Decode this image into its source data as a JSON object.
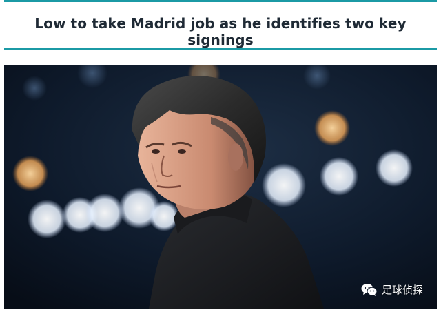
{
  "article": {
    "headline": "Low to take Madrid job as he identifies two key signings"
  },
  "photo": {
    "subject": "man-portrait",
    "watermark_text": "足球侦探"
  },
  "colors": {
    "accent_rule": "#1b9aa5",
    "headline_text": "#1f2a35",
    "photo_background": "#0b1524"
  },
  "icons": {
    "watermark_icon": "wechat-icon"
  }
}
